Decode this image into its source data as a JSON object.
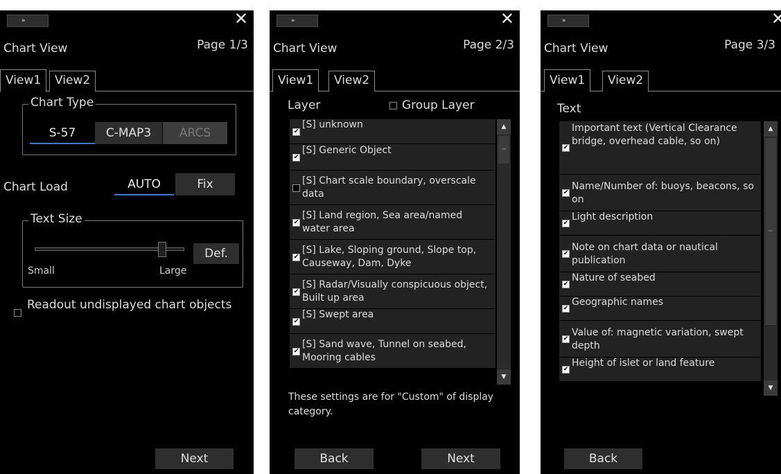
{
  "panels": [
    {
      "expand_icon": "»",
      "close_icon": "✕",
      "title": "Chart View",
      "page": "Page 1/3",
      "tabs": [
        "View1",
        "View2"
      ],
      "chart_type": {
        "legend": "Chart Type",
        "options": [
          "S-57",
          "C-MAP3",
          "ARCS"
        ],
        "selected": "S-57",
        "disabled": "ARCS"
      },
      "chart_load": {
        "label": "Chart Load",
        "options": [
          "AUTO",
          "Fix"
        ],
        "selected": "AUTO"
      },
      "text_size": {
        "legend": "Text Size",
        "min_label": "Small",
        "max_label": "Large",
        "default_button": "Def.",
        "level": 0.85
      },
      "readout": {
        "label": "Readout undisplayed chart objects",
        "checked": false
      },
      "next_button": "Next"
    },
    {
      "expand_icon": "»",
      "close_icon": "✕",
      "title": "Chart View",
      "page": "Page 2/3",
      "tabs": [
        "View1",
        "View2"
      ],
      "layer_label": "Layer",
      "group_layer_label": "Group Layer",
      "group_layer_checked": false,
      "layers": [
        {
          "label": "[S] unknown",
          "checked": true
        },
        {
          "label": "[S] Generic Object",
          "checked": true
        },
        {
          "label": "[S] Chart scale boundary, overscale data",
          "checked": false
        },
        {
          "label": "[S] Land region, Sea area/named water area",
          "checked": true
        },
        {
          "label": "[S] Lake, Sloping ground, Slope top, Causeway, Dam, Dyke",
          "checked": true
        },
        {
          "label": "[S] Radar/Visually conspicuous object, Built up area",
          "checked": true
        },
        {
          "label": "[S] Swept area",
          "checked": true
        },
        {
          "label": "[S] Sand wave, Tunnel on seabed, Mooring cables",
          "checked": true
        }
      ],
      "note": "These settings are for \"Custom\" of display category.",
      "back_button": "Back",
      "next_button": "Next"
    },
    {
      "expand_icon": "»",
      "close_icon": "✕",
      "title": "Chart View",
      "page": "Page 3/3",
      "tabs": [
        "View1",
        "View2"
      ],
      "text_label": "Text",
      "text_items": [
        {
          "label": "Important text (Vertical Clearance bridge, overhead cable, so on)",
          "checked": true
        },
        {
          "label": "Name/Number of: buoys, beacons, so on",
          "checked": true
        },
        {
          "label": "Light description",
          "checked": true
        },
        {
          "label": "Note on chart data or nautical publication",
          "checked": true
        },
        {
          "label": "Nature of seabed",
          "checked": true
        },
        {
          "label": "Geographic names",
          "checked": true
        },
        {
          "label": "Value of: magnetic variation, swept depth",
          "checked": true
        },
        {
          "label": "Height of islet or land feature",
          "checked": true
        }
      ],
      "back_button": "Back"
    }
  ],
  "scroll_icons": {
    "up": "▲",
    "down": "▼",
    "grip": "═"
  },
  "check_mark": "✔"
}
